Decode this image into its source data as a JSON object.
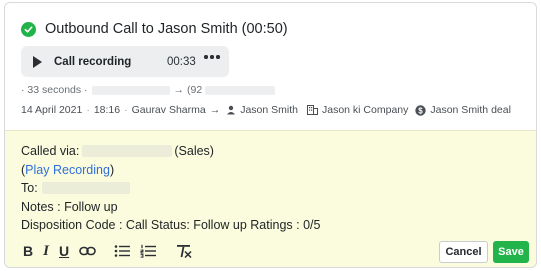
{
  "call": {
    "title": "Outbound Call to Jason Smith (00:50)",
    "status_color": "#21b34a"
  },
  "player": {
    "label": "Call recording",
    "duration": "00:33"
  },
  "meta": {
    "duration_text": "· 33 seconds ·",
    "arrow": "→",
    "to_number_partial": "(92"
  },
  "info": {
    "date": "14 April 2021",
    "sep": "·",
    "time": "18:16",
    "sep2": "·",
    "caller": "Gaurav Sharma",
    "arrow": "→",
    "contact": "Jason Smith",
    "company": "Jason ki Company",
    "deal": "Jason Smith deal"
  },
  "note": {
    "called_via_label": "Called via:",
    "called_via_suffix": "(Sales)",
    "play_open": "(",
    "play_link": "Play Recording",
    "play_close": ")",
    "to_label": "To:",
    "notes_line": "Notes : Follow up",
    "disposition_line": "Disposition Code : Call Status: Follow up Ratings : 0/5"
  },
  "toolbar": {
    "bold": "B",
    "italic": "I",
    "underline": "U"
  },
  "actions": {
    "cancel_label": "Cancel",
    "save_label": "Save",
    "save_color": "#22b34b"
  }
}
